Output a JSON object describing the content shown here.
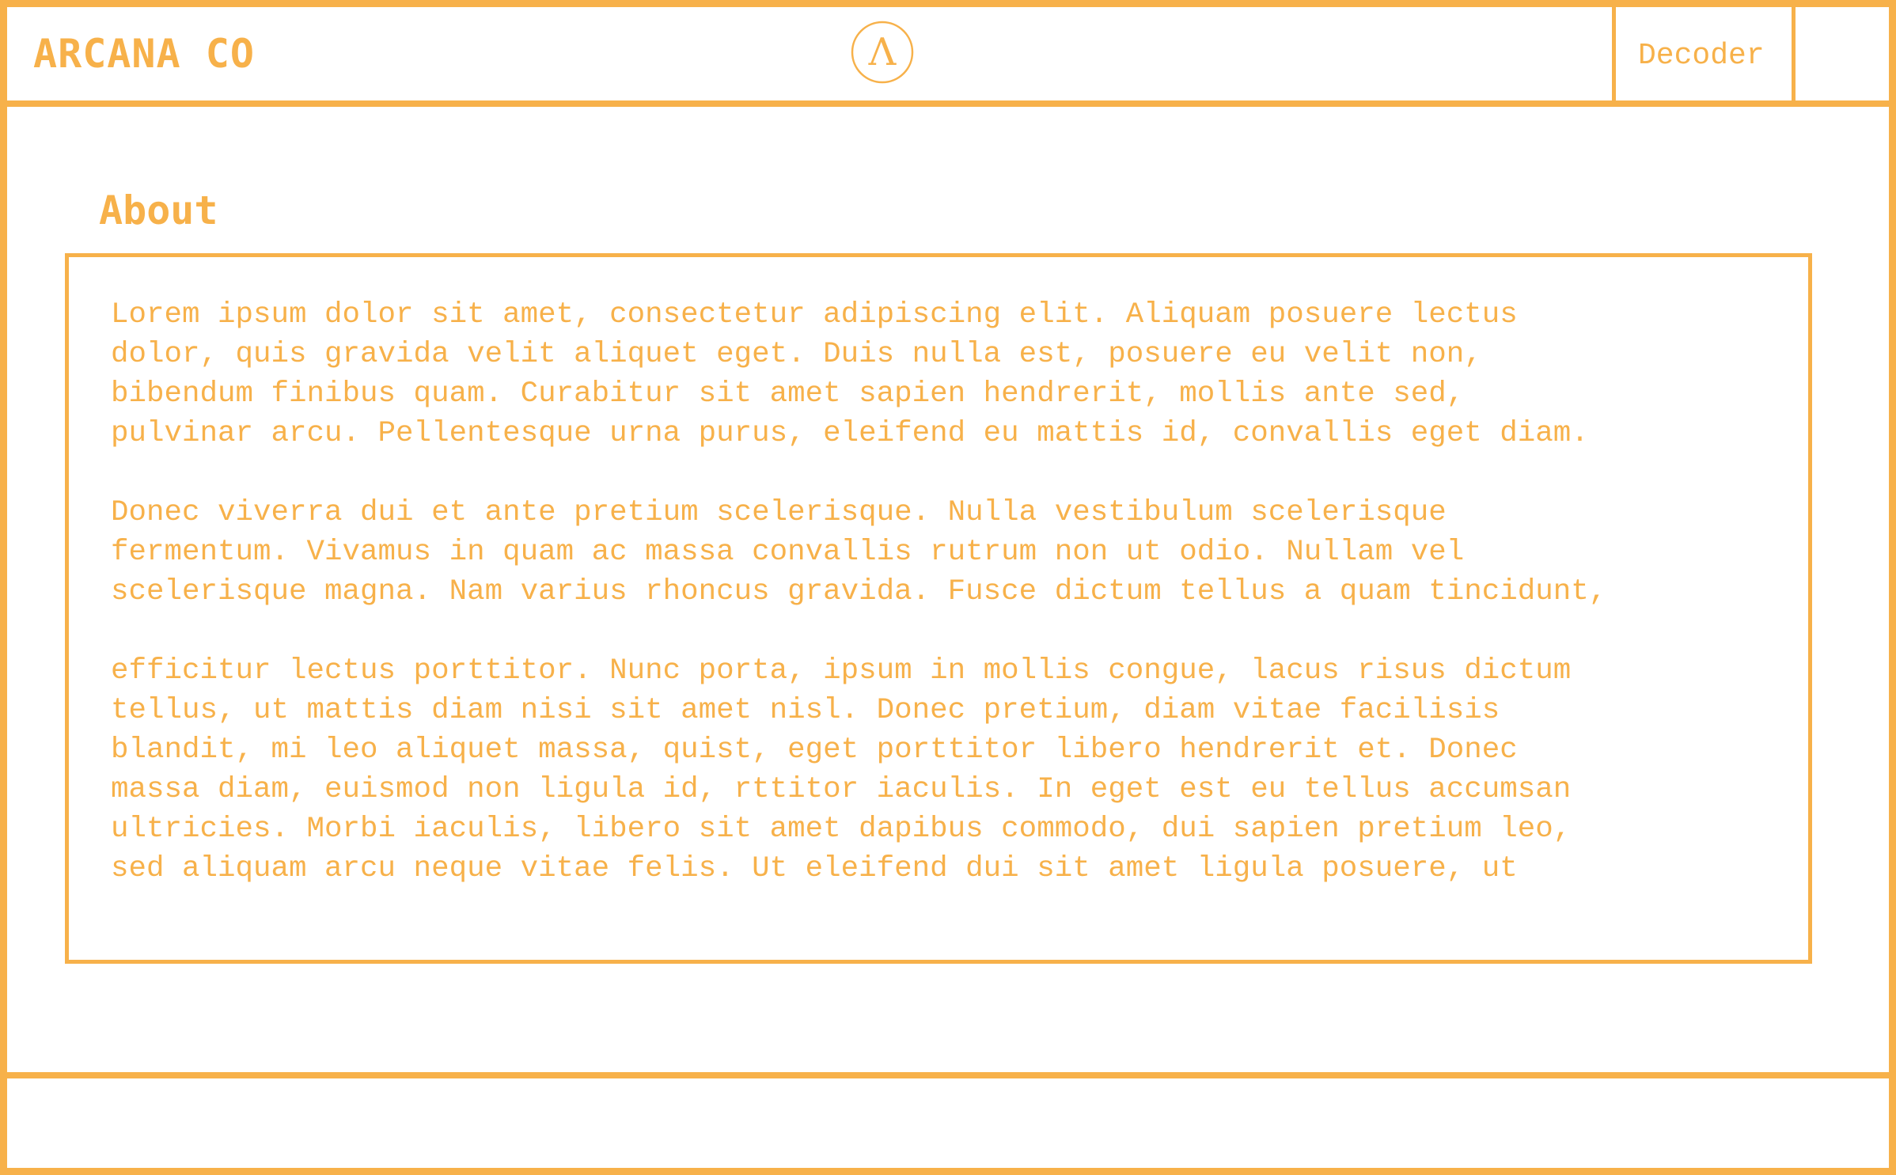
{
  "colors": {
    "accent": "#f7b14a",
    "background": "#ffffff"
  },
  "header": {
    "brand": "ARCANA CO",
    "logo_icon": "lambda-circle-logo-icon",
    "logo_glyph": "Λ",
    "nav": {
      "decoder": "Decoder"
    }
  },
  "main": {
    "title": "About",
    "paragraphs": [
      "Lorem ipsum dolor sit amet, consectetur adipiscing elit. Aliquam posuere lectus\ndolor, quis gravida velit aliquet eget. Duis nulla est, posuere eu velit non,\nbibendum finibus quam. Curabitur sit amet sapien hendrerit, mollis ante sed,\npulvinar arcu. Pellentesque urna purus, eleifend eu mattis id, convallis eget diam.",
      "Donec viverra dui et ante pretium scelerisque. Nulla vestibulum scelerisque\nfermentum. Vivamus in quam ac massa convallis rutrum non ut odio. Nullam vel\nscelerisque magna. Nam varius rhoncus gravida. Fusce dictum tellus a quam tincidunt,",
      "efficitur lectus porttitor. Nunc porta, ipsum in mollis congue, lacus risus dictum\ntellus, ut mattis diam nisi sit amet nisl. Donec pretium, diam vitae facilisis\nblandit, mi leo aliquet massa, quist, eget porttitor libero hendrerit et. Donec\nmassa diam, euismod non ligula id, rttitor iaculis. In eget est eu tellus accumsan\nultricies. Morbi iaculis, libero sit amet dapibus commodo, dui sapien pretium leo,\nsed aliquam arcu neque vitae felis. Ut eleifend dui sit amet ligula posuere, ut"
    ]
  }
}
